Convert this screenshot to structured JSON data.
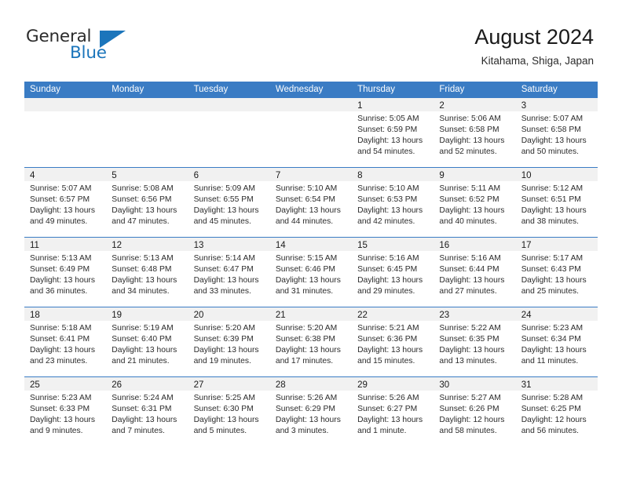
{
  "logo": {
    "word1": "General",
    "word2": "Blue",
    "triangle_color": "#1b75bb"
  },
  "header": {
    "title": "August 2024",
    "location": "Kitahama, Shiga, Japan"
  },
  "theme": {
    "header_blue": "#3a7cc4",
    "daynum_band": "#f1f1f1",
    "text": "#2b2b2b"
  },
  "weekdays": [
    "Sunday",
    "Monday",
    "Tuesday",
    "Wednesday",
    "Thursday",
    "Friday",
    "Saturday"
  ],
  "weeks": [
    [
      {
        "day": "",
        "sunrise": "",
        "sunset": "",
        "daylight1": "",
        "daylight2": ""
      },
      {
        "day": "",
        "sunrise": "",
        "sunset": "",
        "daylight1": "",
        "daylight2": ""
      },
      {
        "day": "",
        "sunrise": "",
        "sunset": "",
        "daylight1": "",
        "daylight2": ""
      },
      {
        "day": "",
        "sunrise": "",
        "sunset": "",
        "daylight1": "",
        "daylight2": ""
      },
      {
        "day": "1",
        "sunrise": "Sunrise: 5:05 AM",
        "sunset": "Sunset: 6:59 PM",
        "daylight1": "Daylight: 13 hours",
        "daylight2": "and 54 minutes."
      },
      {
        "day": "2",
        "sunrise": "Sunrise: 5:06 AM",
        "sunset": "Sunset: 6:58 PM",
        "daylight1": "Daylight: 13 hours",
        "daylight2": "and 52 minutes."
      },
      {
        "day": "3",
        "sunrise": "Sunrise: 5:07 AM",
        "sunset": "Sunset: 6:58 PM",
        "daylight1": "Daylight: 13 hours",
        "daylight2": "and 50 minutes."
      }
    ],
    [
      {
        "day": "4",
        "sunrise": "Sunrise: 5:07 AM",
        "sunset": "Sunset: 6:57 PM",
        "daylight1": "Daylight: 13 hours",
        "daylight2": "and 49 minutes."
      },
      {
        "day": "5",
        "sunrise": "Sunrise: 5:08 AM",
        "sunset": "Sunset: 6:56 PM",
        "daylight1": "Daylight: 13 hours",
        "daylight2": "and 47 minutes."
      },
      {
        "day": "6",
        "sunrise": "Sunrise: 5:09 AM",
        "sunset": "Sunset: 6:55 PM",
        "daylight1": "Daylight: 13 hours",
        "daylight2": "and 45 minutes."
      },
      {
        "day": "7",
        "sunrise": "Sunrise: 5:10 AM",
        "sunset": "Sunset: 6:54 PM",
        "daylight1": "Daylight: 13 hours",
        "daylight2": "and 44 minutes."
      },
      {
        "day": "8",
        "sunrise": "Sunrise: 5:10 AM",
        "sunset": "Sunset: 6:53 PM",
        "daylight1": "Daylight: 13 hours",
        "daylight2": "and 42 minutes."
      },
      {
        "day": "9",
        "sunrise": "Sunrise: 5:11 AM",
        "sunset": "Sunset: 6:52 PM",
        "daylight1": "Daylight: 13 hours",
        "daylight2": "and 40 minutes."
      },
      {
        "day": "10",
        "sunrise": "Sunrise: 5:12 AM",
        "sunset": "Sunset: 6:51 PM",
        "daylight1": "Daylight: 13 hours",
        "daylight2": "and 38 minutes."
      }
    ],
    [
      {
        "day": "11",
        "sunrise": "Sunrise: 5:13 AM",
        "sunset": "Sunset: 6:49 PM",
        "daylight1": "Daylight: 13 hours",
        "daylight2": "and 36 minutes."
      },
      {
        "day": "12",
        "sunrise": "Sunrise: 5:13 AM",
        "sunset": "Sunset: 6:48 PM",
        "daylight1": "Daylight: 13 hours",
        "daylight2": "and 34 minutes."
      },
      {
        "day": "13",
        "sunrise": "Sunrise: 5:14 AM",
        "sunset": "Sunset: 6:47 PM",
        "daylight1": "Daylight: 13 hours",
        "daylight2": "and 33 minutes."
      },
      {
        "day": "14",
        "sunrise": "Sunrise: 5:15 AM",
        "sunset": "Sunset: 6:46 PM",
        "daylight1": "Daylight: 13 hours",
        "daylight2": "and 31 minutes."
      },
      {
        "day": "15",
        "sunrise": "Sunrise: 5:16 AM",
        "sunset": "Sunset: 6:45 PM",
        "daylight1": "Daylight: 13 hours",
        "daylight2": "and 29 minutes."
      },
      {
        "day": "16",
        "sunrise": "Sunrise: 5:16 AM",
        "sunset": "Sunset: 6:44 PM",
        "daylight1": "Daylight: 13 hours",
        "daylight2": "and 27 minutes."
      },
      {
        "day": "17",
        "sunrise": "Sunrise: 5:17 AM",
        "sunset": "Sunset: 6:43 PM",
        "daylight1": "Daylight: 13 hours",
        "daylight2": "and 25 minutes."
      }
    ],
    [
      {
        "day": "18",
        "sunrise": "Sunrise: 5:18 AM",
        "sunset": "Sunset: 6:41 PM",
        "daylight1": "Daylight: 13 hours",
        "daylight2": "and 23 minutes."
      },
      {
        "day": "19",
        "sunrise": "Sunrise: 5:19 AM",
        "sunset": "Sunset: 6:40 PM",
        "daylight1": "Daylight: 13 hours",
        "daylight2": "and 21 minutes."
      },
      {
        "day": "20",
        "sunrise": "Sunrise: 5:20 AM",
        "sunset": "Sunset: 6:39 PM",
        "daylight1": "Daylight: 13 hours",
        "daylight2": "and 19 minutes."
      },
      {
        "day": "21",
        "sunrise": "Sunrise: 5:20 AM",
        "sunset": "Sunset: 6:38 PM",
        "daylight1": "Daylight: 13 hours",
        "daylight2": "and 17 minutes."
      },
      {
        "day": "22",
        "sunrise": "Sunrise: 5:21 AM",
        "sunset": "Sunset: 6:36 PM",
        "daylight1": "Daylight: 13 hours",
        "daylight2": "and 15 minutes."
      },
      {
        "day": "23",
        "sunrise": "Sunrise: 5:22 AM",
        "sunset": "Sunset: 6:35 PM",
        "daylight1": "Daylight: 13 hours",
        "daylight2": "and 13 minutes."
      },
      {
        "day": "24",
        "sunrise": "Sunrise: 5:23 AM",
        "sunset": "Sunset: 6:34 PM",
        "daylight1": "Daylight: 13 hours",
        "daylight2": "and 11 minutes."
      }
    ],
    [
      {
        "day": "25",
        "sunrise": "Sunrise: 5:23 AM",
        "sunset": "Sunset: 6:33 PM",
        "daylight1": "Daylight: 13 hours",
        "daylight2": "and 9 minutes."
      },
      {
        "day": "26",
        "sunrise": "Sunrise: 5:24 AM",
        "sunset": "Sunset: 6:31 PM",
        "daylight1": "Daylight: 13 hours",
        "daylight2": "and 7 minutes."
      },
      {
        "day": "27",
        "sunrise": "Sunrise: 5:25 AM",
        "sunset": "Sunset: 6:30 PM",
        "daylight1": "Daylight: 13 hours",
        "daylight2": "and 5 minutes."
      },
      {
        "day": "28",
        "sunrise": "Sunrise: 5:26 AM",
        "sunset": "Sunset: 6:29 PM",
        "daylight1": "Daylight: 13 hours",
        "daylight2": "and 3 minutes."
      },
      {
        "day": "29",
        "sunrise": "Sunrise: 5:26 AM",
        "sunset": "Sunset: 6:27 PM",
        "daylight1": "Daylight: 13 hours",
        "daylight2": "and 1 minute."
      },
      {
        "day": "30",
        "sunrise": "Sunrise: 5:27 AM",
        "sunset": "Sunset: 6:26 PM",
        "daylight1": "Daylight: 12 hours",
        "daylight2": "and 58 minutes."
      },
      {
        "day": "31",
        "sunrise": "Sunrise: 5:28 AM",
        "sunset": "Sunset: 6:25 PM",
        "daylight1": "Daylight: 12 hours",
        "daylight2": "and 56 minutes."
      }
    ]
  ]
}
